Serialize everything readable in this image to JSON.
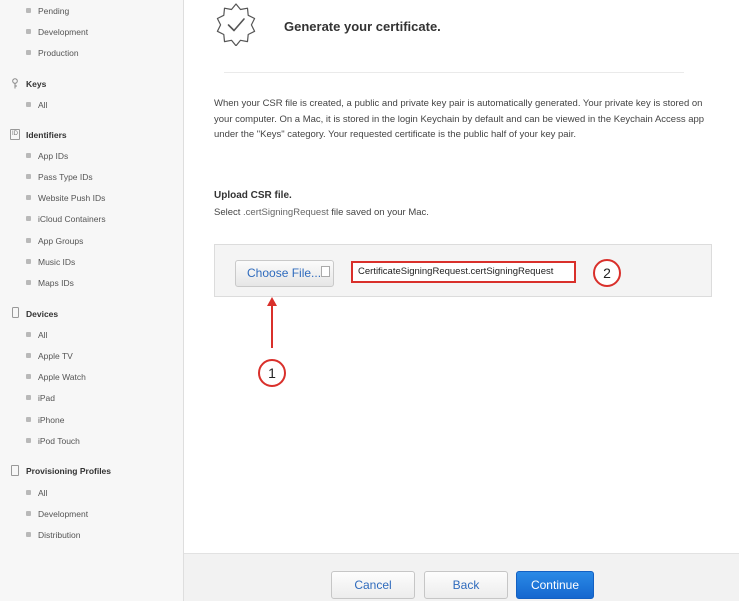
{
  "sidebar": {
    "certificates_items": [
      "Pending",
      "Development",
      "Production"
    ],
    "keys": {
      "label": "Keys",
      "items": [
        "All"
      ]
    },
    "identifiers": {
      "label": "Identifiers",
      "items": [
        "App IDs",
        "Pass Type IDs",
        "Website Push IDs",
        "iCloud Containers",
        "App Groups",
        "Music IDs",
        "Maps IDs"
      ]
    },
    "devices": {
      "label": "Devices",
      "items": [
        "All",
        "Apple TV",
        "Apple Watch",
        "iPad",
        "iPhone",
        "iPod Touch"
      ]
    },
    "profiles": {
      "label": "Provisioning Profiles",
      "items": [
        "All",
        "Development",
        "Distribution"
      ]
    }
  },
  "main": {
    "title": "Generate your certificate.",
    "intro": "When your CSR file is created, a public and private key pair is automatically generated. Your private key is stored on your computer. On a Mac, it is stored in the login Keychain by default and can be viewed in the Keychain Access app under the \"Keys\" category. Your requested certificate is the public half of your key pair.",
    "upload_title": "Upload CSR file.",
    "upload_sub_prefix": "Select ",
    "upload_sub_mono": ".certSigningRequest",
    "upload_sub_suffix": " file saved on your Mac.",
    "choose_file_label": "Choose File...",
    "selected_filename": "CertificateSigningRequest.certSigningRequest",
    "step_1": "1",
    "step_2": "2"
  },
  "footer": {
    "cancel": "Cancel",
    "back": "Back",
    "continue": "Continue"
  },
  "colors": {
    "accent": "#2f6bbd",
    "primary_button": "#1a73d9",
    "annotation": "#d9302b"
  }
}
